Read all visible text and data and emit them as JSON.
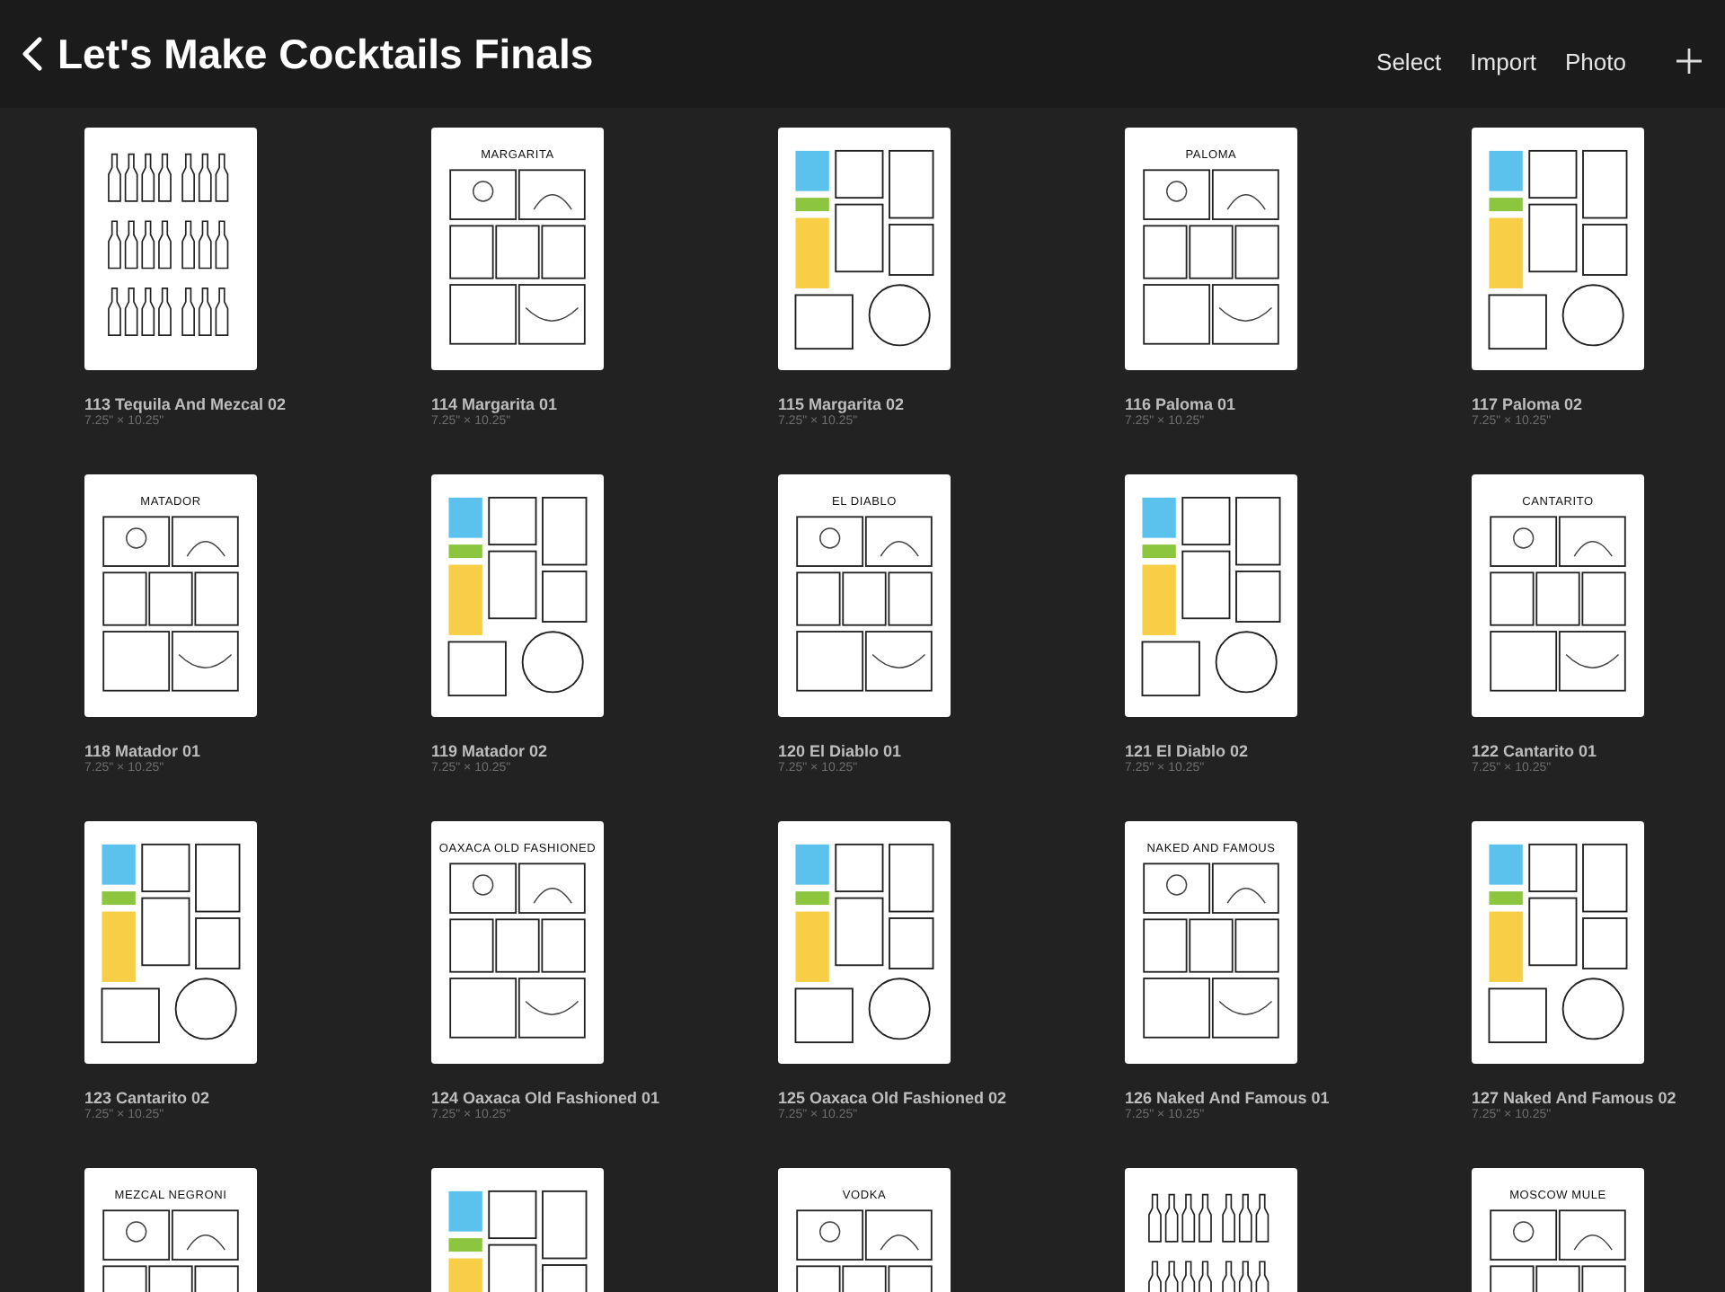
{
  "header": {
    "title": "Let's Make Cocktails Finals",
    "actions": [
      "Select",
      "Import",
      "Photo"
    ]
  },
  "artworks": [
    {
      "name": "113 Tequila And Mezcal 02",
      "size": "7.25\" × 10.25\"",
      "kind": "bottles"
    },
    {
      "name": "114 Margarita 01",
      "size": "7.25\" × 10.25\"",
      "kind": "panels",
      "heading": "MARGARITA"
    },
    {
      "name": "115 Margarita 02",
      "size": "7.25\" × 10.25\"",
      "kind": "swatches"
    },
    {
      "name": "116 Paloma 01",
      "size": "7.25\" × 10.25\"",
      "kind": "panels",
      "heading": "PALOMA"
    },
    {
      "name": "117 Paloma 02",
      "size": "7.25\" × 10.25\"",
      "kind": "swatches"
    },
    {
      "name": "118 Matador 01",
      "size": "7.25\" × 10.25\"",
      "kind": "panels",
      "heading": "MATADOR"
    },
    {
      "name": "119 Matador 02",
      "size": "7.25\" × 10.25\"",
      "kind": "swatches"
    },
    {
      "name": "120 El Diablo 01",
      "size": "7.25\" × 10.25\"",
      "kind": "panels",
      "heading": "EL DIABLO"
    },
    {
      "name": "121 El Diablo 02",
      "size": "7.25\" × 10.25\"",
      "kind": "swatches"
    },
    {
      "name": "122 Cantarito 01",
      "size": "7.25\" × 10.25\"",
      "kind": "panels",
      "heading": "CANTARITO"
    },
    {
      "name": "123 Cantarito 02",
      "size": "7.25\" × 10.25\"",
      "kind": "swatches"
    },
    {
      "name": "124 Oaxaca Old Fashioned 01",
      "size": "7.25\" × 10.25\"",
      "kind": "panels",
      "heading": "OAXACA OLD FASHIONED"
    },
    {
      "name": "125 Oaxaca Old Fashioned 02",
      "size": "7.25\" × 10.25\"",
      "kind": "swatches"
    },
    {
      "name": "126 Naked And Famous 01",
      "size": "7.25\" × 10.25\"",
      "kind": "panels",
      "heading": "NAKED AND FAMOUS"
    },
    {
      "name": "127 Naked And Famous 02",
      "size": "7.25\" × 10.25\"",
      "kind": "swatches"
    },
    {
      "kind": "panels",
      "heading": "MEZCAL NEGRONI"
    },
    {
      "kind": "swatches"
    },
    {
      "kind": "panels",
      "heading": "VODKA"
    },
    {
      "kind": "bottles"
    },
    {
      "kind": "panels",
      "heading": "MOSCOW MULE"
    }
  ]
}
